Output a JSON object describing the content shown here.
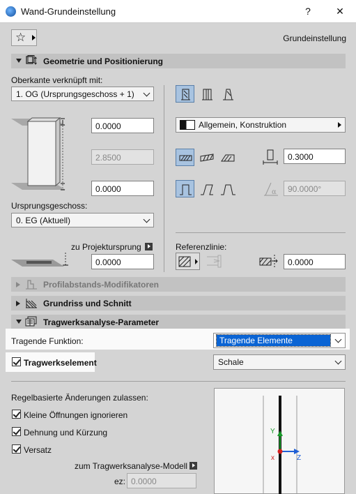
{
  "window": {
    "title": "Wand-Grundeinstellung",
    "help_label": "?",
    "close_label": "✕"
  },
  "header": {
    "preset_label": "Grundeinstellung"
  },
  "sections": {
    "geometry": "Geometrie und Positionierung",
    "profile_mods": "Profilabstands-Modifikatoren",
    "floorplan": "Grundriss und Schnitt",
    "structural": "Tragwerksanalyse-Parameter"
  },
  "geometry": {
    "top_linked_label": "Oberkante verknüpft mit:",
    "top_linked_value": "1. OG (Ursprungsgeschoss + 1)",
    "top_offset": "0.0000",
    "height": "2.8500",
    "bottom_offset": "0.0000",
    "home_story_label": "Ursprungsgeschoss:",
    "home_story_value": "0. EG (Aktuell)",
    "project_zero_label": "zu Projektursprung",
    "project_zero_value": "0.0000",
    "composite_label": "Allgemein, Konstruktion",
    "thickness": "0.3000",
    "slant_angle": "90.0000°",
    "refline_label": "Referenzlinie:",
    "refline_offset": "0.0000"
  },
  "structural": {
    "function_label": "Tragende Funktion:",
    "function_value": "Tragende Elemente",
    "element_label": "Tragwerkselement",
    "element_checked": true,
    "type_value": "Schale",
    "rules_label": "Regelbasierte Änderungen zulassen:",
    "rule_items": [
      {
        "label": "Kleine Öffnungen ignorieren",
        "checked": true
      },
      {
        "label": "Dehnung und Kürzung",
        "checked": true
      },
      {
        "label": "Versatz",
        "checked": true
      }
    ],
    "model_label": "zum Tragwerksanalyse-Modell",
    "ez_label": "ez:",
    "ez_value": "0.0000",
    "axis_y": "Y",
    "axis_z": "Z"
  },
  "colors": {
    "selection": "#0a64d4",
    "axis_green": "#1a9a2a",
    "axis_blue": "#1f5fd6",
    "axis_red": "#d42020"
  }
}
